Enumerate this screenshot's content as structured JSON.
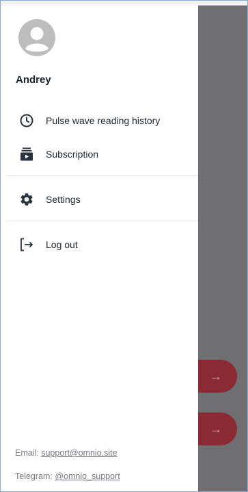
{
  "user": {
    "name": "Andrey",
    "avatar_icon": "account-circle-icon"
  },
  "menu": {
    "history": {
      "label": "Pulse wave reading history",
      "icon": "clock-icon"
    },
    "subscription": {
      "label": "Subscription",
      "icon": "subscription-icon"
    },
    "settings": {
      "label": "Settings",
      "icon": "gear-icon"
    },
    "logout": {
      "label": "Log out",
      "icon": "logout-icon"
    }
  },
  "contacts": {
    "email_prefix": "Email:",
    "email_value": "support@omnio.site",
    "telegram_prefix": "Telegram:",
    "telegram_value": "@omnio_support"
  },
  "background": {
    "button_icon": "arrow-right-icon",
    "arrow_glyph": "→",
    "button_color": "#8a2b33",
    "overlay_color": "#6f6f71"
  }
}
